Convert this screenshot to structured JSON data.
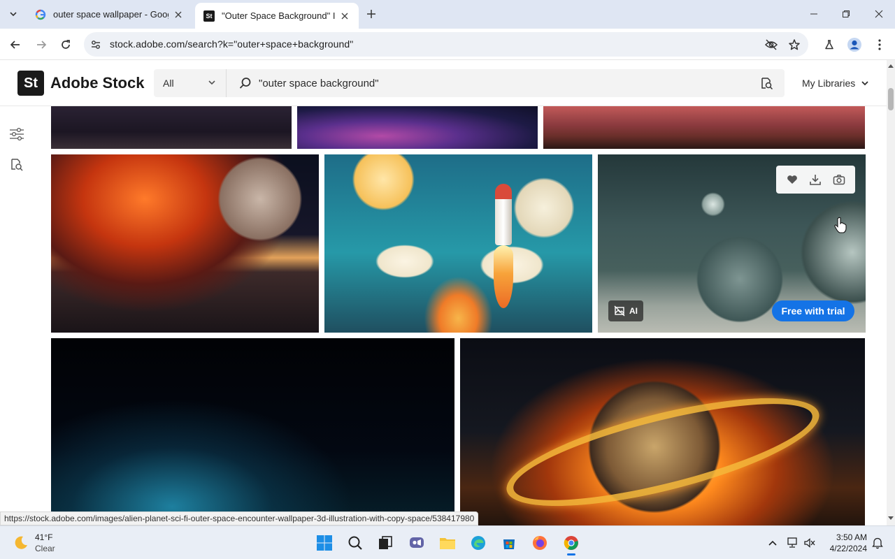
{
  "browser": {
    "tabs": [
      {
        "title": "outer space wallpaper - Googl",
        "favicon": "google-icon",
        "active": false
      },
      {
        "title": "\"Outer Space Background\" Im",
        "favicon": "adobe-stock-icon",
        "active": true
      }
    ],
    "url": "stock.adobe.com/search?k=\"outer+space+background\"",
    "status_url": "https://stock.adobe.com/images/alien-planet-sci-fi-outer-space-encounter-wallpaper-3d-illustration-with-copy-space/538417980"
  },
  "header": {
    "logo_mark": "St",
    "logo_text": "Adobe Stock",
    "filter_value": "All",
    "search_value": "\"outer space background\"",
    "my_libraries": "My Libraries"
  },
  "tiles": {
    "ai_badge": "AI",
    "free_with_trial": "Free with trial"
  },
  "taskbar": {
    "weather_temp": "41°F",
    "weather_cond": "Clear",
    "time": "3:50 AM",
    "date": "4/22/2024"
  },
  "colors": {
    "accent_blue": "#1473e6",
    "tabstrip": "#dfe6f3",
    "taskbar": "#e9eef6"
  }
}
